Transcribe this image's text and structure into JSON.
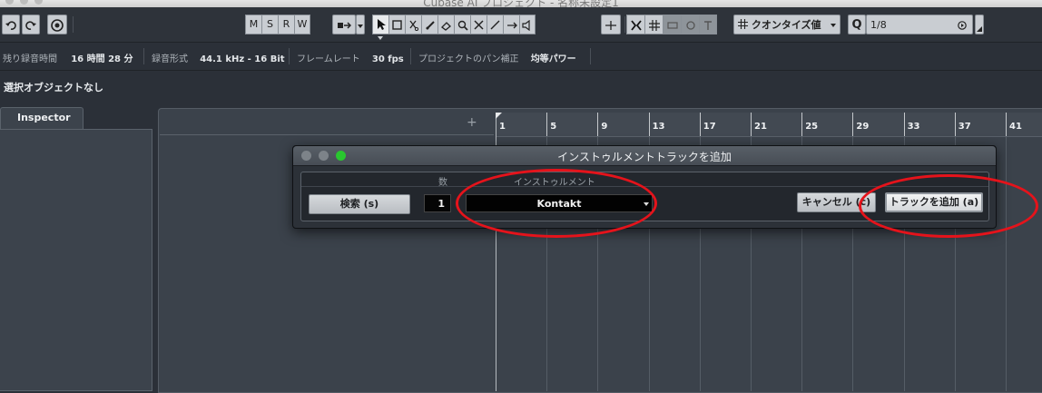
{
  "window": {
    "title": "Cubase AI プロジェクト - 名称未設定1"
  },
  "toolbar": {
    "msrw": [
      "M",
      "S",
      "R",
      "W"
    ],
    "quantize_label": "クオンタイズ値",
    "quantize_value": "1/8",
    "q_label": "Q"
  },
  "infobar": {
    "remaining_label": "残り録音時間",
    "remaining_value": "16 時間 28 分",
    "format_label": "録音形式",
    "format_value": "44.1 kHz - 16 Bit",
    "framerate_label": "フレームレート",
    "framerate_value": "30 fps",
    "pan_label": "プロジェクトのパン補正",
    "pan_value": "均等パワー"
  },
  "selection_status": "選択オブジェクトなし",
  "inspector": {
    "tab_label": "Inspector"
  },
  "ruler": {
    "bars": [
      "1",
      "5",
      "9",
      "13",
      "17",
      "21",
      "25",
      "29",
      "33",
      "37",
      "41"
    ]
  },
  "dialog": {
    "title": "インストゥルメントトラックを追加",
    "count_header": "数",
    "instrument_header": "インストゥルメント",
    "search_button": "検索 (s)",
    "count_value": "1",
    "instrument_value": "Kontakt",
    "cancel_button": "キャンセル (c)",
    "add_button": "トラックを追加 (a)"
  },
  "colors": {
    "annotation_red": "#e5131b",
    "background": "#2b3038",
    "dialog_green_light": "#29c72f"
  }
}
